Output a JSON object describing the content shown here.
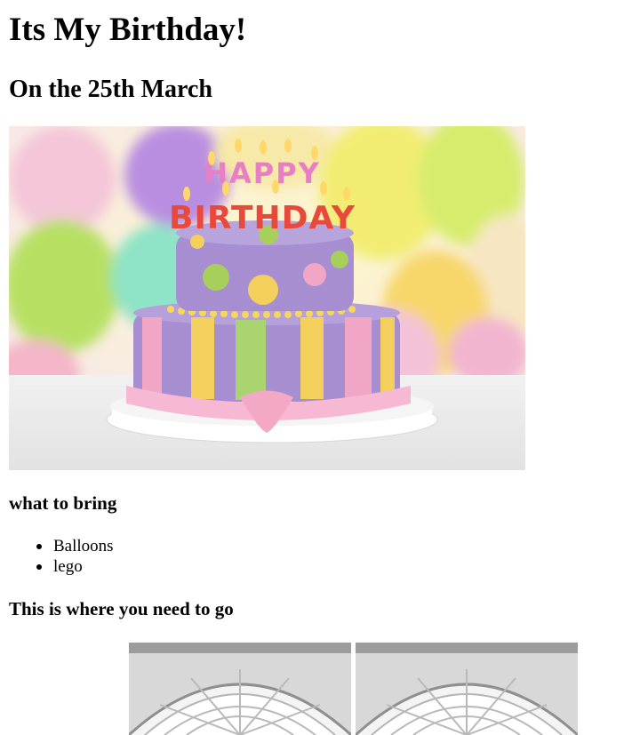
{
  "page": {
    "title": "Its My Birthday!",
    "subtitle": "On the 25th March"
  },
  "cake_image": {
    "candle_text_top": "HAPPY",
    "candle_text_bottom": "BIRTHDAY",
    "colors": {
      "tier": "#a78ed0",
      "stripe_yellow": "#f3cf5b",
      "stripe_green": "#a9d46f",
      "stripe_pink": "#f1a6c6",
      "ribbon": "#f6b8d2"
    }
  },
  "bring": {
    "heading": "what to bring",
    "items": [
      "Balloons",
      "lego"
    ]
  },
  "directions": {
    "heading": "This is where you need to go",
    "images": [
      "dome-skylight-photo",
      "dome-skylight-photo"
    ]
  }
}
